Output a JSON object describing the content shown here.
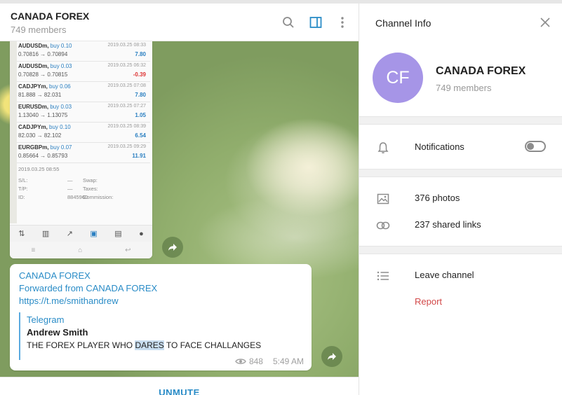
{
  "chat": {
    "title": "CANADA FOREX",
    "members": "749 members",
    "unmute_label": "UNMUTE"
  },
  "screenshot": {
    "trades": [
      {
        "pair": "AUDUSDm,",
        "side": "buy 0.10",
        "prices": "0.70816 → 0.70894",
        "date": "2019.03.25 08:33",
        "pl": "7.80",
        "negative": false
      },
      {
        "pair": "AUDUSDm,",
        "side": "buy 0.03",
        "prices": "0.70828 → 0.70815",
        "date": "2019.03.25 06:32",
        "pl": "-0.39",
        "negative": true
      },
      {
        "pair": "CADJPYm,",
        "side": "buy 0.06",
        "prices": "81.888 → 82.031",
        "date": "2019.03.25 07:08",
        "pl": "7.80",
        "negative": false
      },
      {
        "pair": "EURUSDm,",
        "side": "buy 0.03",
        "prices": "1.13040 → 1.13075",
        "date": "2019.03.25 07:27",
        "pl": "1.05",
        "negative": false
      },
      {
        "pair": "CADJPYm,",
        "side": "buy 0.10",
        "prices": "82.030 → 82.102",
        "date": "2019.03.25 08:39",
        "pl": "6.54",
        "negative": false
      },
      {
        "pair": "EURGBPm,",
        "side": "buy 0.07",
        "prices": "0.85664 → 0.85793",
        "date": "2019.03.25 09:29",
        "pl": "11.91",
        "negative": false
      }
    ],
    "last_date": "2019.03.25 08:55",
    "summary": [
      {
        "l": "S/L:",
        "lv": "—",
        "m": "Swap:",
        "r": "0.00"
      },
      {
        "l": "T/P:",
        "lv": "—",
        "m": "Taxes:",
        "r": "0.00"
      },
      {
        "l": "ID:",
        "lv": "8845960",
        "m": "Commission:",
        "r": "0.00"
      }
    ]
  },
  "message": {
    "channel": "CANADA FOREX",
    "forwarded": "Forwarded from CANADA FOREX",
    "link": "https://t.me/smithandrew",
    "quote_source": "Telegram",
    "quote_author": "Andrew Smith",
    "quote_text_before": "THE FOREX PLAYER WHO ",
    "quote_text_highlight": "DARES",
    "quote_text_after": " TO FACE CHALLANGES",
    "views": "848",
    "time": "5:49 AM"
  },
  "info": {
    "title": "Channel Info",
    "avatar_initials": "CF",
    "avatar_color": "#a695e7",
    "name": "CANADA FOREX",
    "members": "749 members",
    "notifications_label": "Notifications",
    "notifications_on": false,
    "photos_label": "376 photos",
    "links_label": "237 shared links",
    "leave_label": "Leave channel",
    "report_label": "Report"
  },
  "colors": {
    "accent": "#2a8cc7",
    "danger": "#d24949"
  }
}
